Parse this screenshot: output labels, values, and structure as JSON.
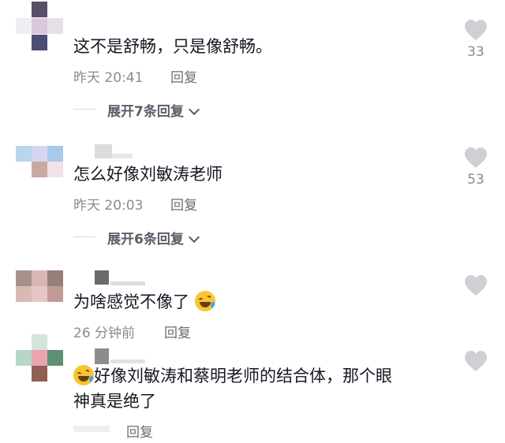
{
  "colors": {
    "accent": "#161823",
    "meta": "#8a8b91",
    "heart": "#cfcfd4"
  },
  "comments": [
    {
      "text": "这不是舒畅，只是像舒畅。",
      "time": "昨天 20:41",
      "reply_label": "回复",
      "expand_label": "展开7条回复",
      "like_count": "33"
    },
    {
      "text": "怎么好像刘敏涛老师",
      "time": "昨天 20:03",
      "reply_label": "回复",
      "expand_label": "展开6条回复",
      "like_count": "53"
    },
    {
      "text": "为啥感觉不像了",
      "time": "26 分钟前",
      "reply_label": "回复",
      "like_count": ""
    },
    {
      "text_line1": "好像刘敏涛和蔡明老师的结合体，那个眼",
      "text_line2": "神真是绝了",
      "time": "",
      "reply_label": "回复",
      "like_count": ""
    }
  ],
  "icons": {
    "like": "heart-icon",
    "expand": "chevron-down-icon",
    "emoji": "rofl-emoji-icon"
  }
}
